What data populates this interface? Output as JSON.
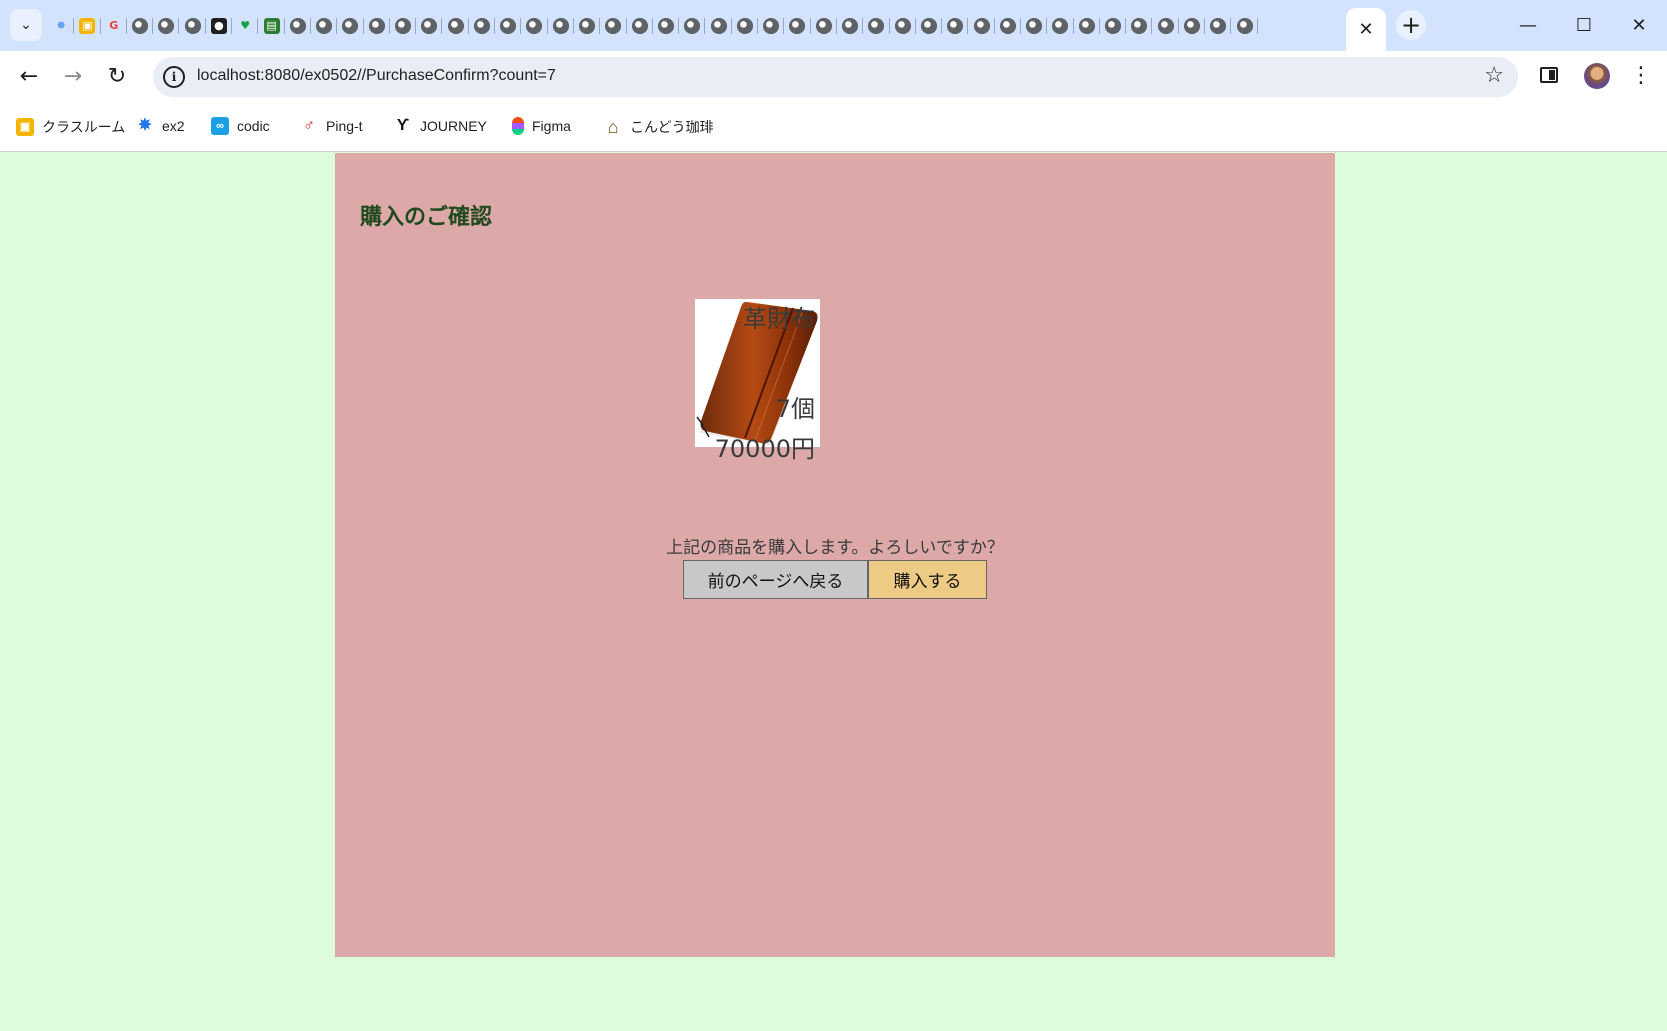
{
  "browser": {
    "active_tab_close": "✕",
    "new_tab": "+",
    "window_controls": {
      "minimize": "—",
      "maximize": "☐",
      "close": "✕"
    },
    "url": "localhost:8080/ex0502//PurchaseConfirm?count=7",
    "bookmarks": [
      {
        "label": "クラスルーム",
        "icon": "classroom-icon"
      },
      {
        "label": "ex2",
        "icon": "gear-icon"
      },
      {
        "label": "codic",
        "icon": "codic-icon"
      },
      {
        "label": "Ping-t",
        "icon": "ping-t-icon"
      },
      {
        "label": "JOURNEY",
        "icon": "journey-icon"
      },
      {
        "label": "Figma",
        "icon": "figma-icon"
      },
      {
        "label": "こんどう珈琲",
        "icon": "house-icon"
      }
    ]
  },
  "page": {
    "title": "購入のご確認",
    "product": {
      "name": "革財布",
      "quantity": "7個",
      "price": "70000円",
      "image": "leather-wallet-image"
    },
    "confirm_message": "上記の商品を購入します。よろしいですか？",
    "back_button": "前のページへ戻る",
    "buy_button": "購入する"
  },
  "colors": {
    "page_background": "#dcfcdc",
    "content_background": "#dca8a8",
    "title_color": "#1e4a1e",
    "buy_button": "#eecb85",
    "back_button": "#c8c8c8"
  }
}
